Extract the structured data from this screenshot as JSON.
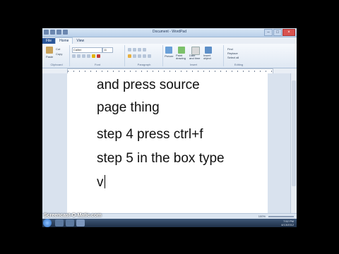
{
  "window": {
    "title": "Document - WordPad"
  },
  "ribbon": {
    "tabs": [
      "File",
      "Home",
      "View"
    ],
    "clipboard": {
      "paste": "Paste",
      "cut": "Cut",
      "copy": "Copy",
      "label": "Clipboard"
    },
    "font": {
      "family": "Calibri",
      "size": "11",
      "label": "Font"
    },
    "paragraph": {
      "label": "Paragraph"
    },
    "insert": {
      "picture": "Picture",
      "paint": "Paint drawing",
      "datetime": "Date and time",
      "object": "Insert object",
      "label": "Insert"
    },
    "editing": {
      "find": "Find",
      "replace": "Replace",
      "selectall": "Select all",
      "label": "Editing"
    }
  },
  "document": {
    "lines": [
      "and press source",
      "page thing",
      "step 4 press ctrl+f",
      "step 5 in the box type",
      "v"
    ]
  },
  "statusbar": {
    "zoom": "100%"
  },
  "taskbar": {
    "time": "7:52 PM",
    "date": "4/13/2012"
  },
  "watermark": "Screencast-O-Matic.com"
}
